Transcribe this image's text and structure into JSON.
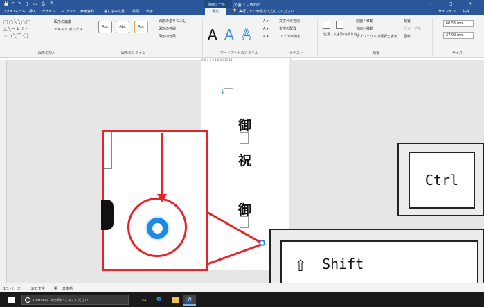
{
  "titlebar": {
    "qat_icons": [
      "save-icon",
      "undo-icon",
      "redo-icon",
      "new-doc-icon",
      "open-icon",
      "print-icon",
      "preview-icon"
    ],
    "context_label": "描画ツール",
    "title": "文書 1 - Word",
    "window_buttons": [
      "─",
      "□",
      "✕"
    ]
  },
  "tabs": [
    "ファイル",
    "ホーム",
    "挿入",
    "デザイン",
    "レイアウト",
    "参考資料",
    "差し込み文書",
    "校閲",
    "表示",
    "書式"
  ],
  "tell_me": "実行したい作業を入力してください...",
  "account": {
    "signin": "サインイン",
    "share": "共有"
  },
  "ribbon": {
    "group_insert_shapes": "図形の挿入",
    "edit_shape": "図形の編集",
    "textbox": "テキスト ボックス",
    "style_sample": "Abc",
    "fill": "図形の塗りつぶし",
    "outline": "図形の枠線",
    "effects": "図形の効果",
    "group_shape_styles": "図形のスタイル",
    "wordart_letter": "A",
    "group_wordart": "ワードアートのスタイル",
    "text_direction": "文字列の方向",
    "text_align": "文字の配置",
    "link": "リンクの作成",
    "group_text": "テキスト",
    "position": "位置",
    "wrap": "文字列の折り返し",
    "forward": "前面へ移動",
    "backward": "背面へ移動",
    "selection": "オブジェクトの選択と表示",
    "align": "配置",
    "group": "グループ化",
    "rotate": "回転",
    "group_arrange": "配置",
    "height": "60.55 mm",
    "width": "27.99 mm",
    "group_size": "サイズ"
  },
  "ruler_marks": "8  6  4  2     2  4     8  10  12  14",
  "document": {
    "kanji_top": "御",
    "kanji_mid": "祝",
    "kanji_bottom": "御"
  },
  "overlay": {
    "ctrl_key": "Ctrl",
    "shift_arrow": "⇧",
    "shift_key": "Shift",
    "accent_color": "#e8232a",
    "handle_color": "#1e88e5"
  },
  "statusbar": {
    "page": "1/1 ページ",
    "words": "2/2 文字",
    "lang": "日本語"
  },
  "taskbar": {
    "cortana": "Cortanaに何か聞いてみてください。"
  }
}
